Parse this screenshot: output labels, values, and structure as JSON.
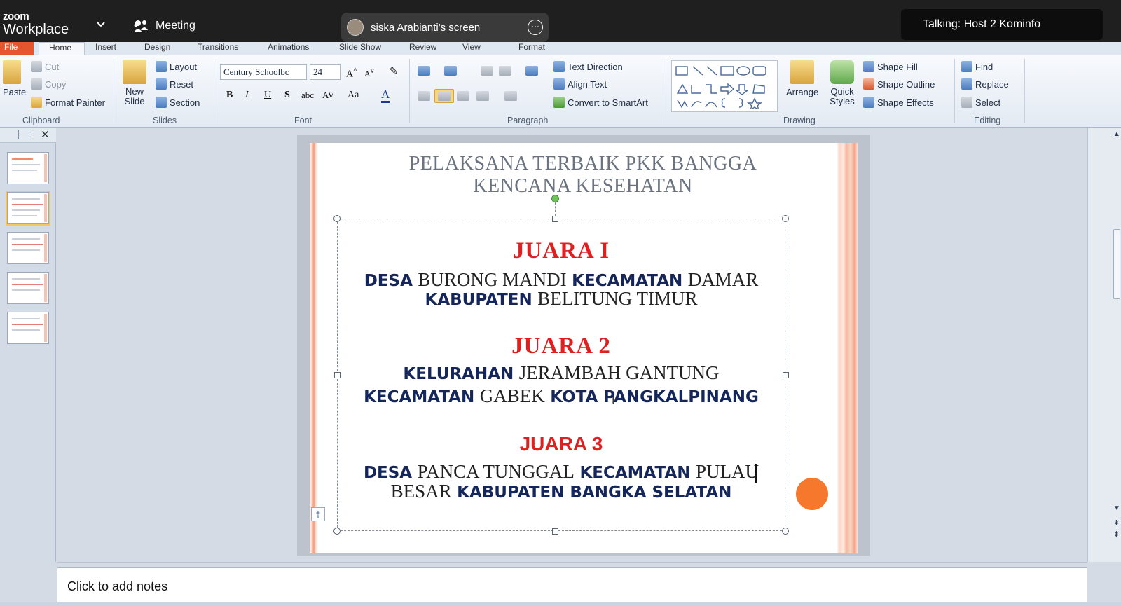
{
  "zoom": {
    "logo_small": "zoom",
    "logo_big": "Workplace",
    "meeting_label": "Meeting",
    "share_label": "siska Arabianti's screen",
    "more_label": "···",
    "talking": "Talking: Host 2 Kominfo"
  },
  "ribbon": {
    "tabs": [
      "File",
      "Home",
      "Insert",
      "Design",
      "Transitions",
      "Animations",
      "Slide Show",
      "Review",
      "View",
      "Format"
    ],
    "clipboard": {
      "paste": "Paste",
      "cut": "Cut",
      "copy": "Copy",
      "format_painter": "Format Painter",
      "group": "Clipboard"
    },
    "slides": {
      "new_slide": "New Slide",
      "layout": "Layout",
      "reset": "Reset",
      "section": "Section",
      "group": "Slides"
    },
    "font": {
      "family": "Century Schoolbc",
      "size": "24",
      "bold": "B",
      "italic": "I",
      "underline": "U",
      "shadow": "S",
      "strike": "abc",
      "spacing": "AV",
      "case": "Aa",
      "color": "A",
      "group": "Font"
    },
    "paragraph": {
      "text_direction": "Text Direction",
      "align_text": "Align Text",
      "convert_smartart": "Convert to SmartArt",
      "group": "Paragraph"
    },
    "drawing": {
      "arrange": "Arrange",
      "quick_styles": "Quick Styles",
      "shape_fill": "Shape Fill",
      "shape_outline": "Shape Outline",
      "shape_effects": "Shape Effects",
      "group": "Drawing"
    },
    "editing": {
      "find": "Find",
      "replace": "Replace",
      "select": "Select",
      "group": "Editing"
    }
  },
  "slide": {
    "title_line1": "PELAKSANA TERBAIK PKK  BANGGA",
    "title_line2": "KENCANA KESEHATAN",
    "j1": "JUARA I",
    "j1_l1": [
      "DESA",
      "BURONG MANDI",
      "KECAMATAN",
      "DAMAR"
    ],
    "j1_l2": [
      "KABUPATEN",
      "BELITUNG TIMUR"
    ],
    "j2": "JUARA 2",
    "j2_l1": [
      "KELURAHAN",
      "JERAMBAH GANTUNG"
    ],
    "j2_l2": [
      "KECAMATAN",
      "GABEK",
      "KOTA PANGKALPINANG"
    ],
    "j3": "JUARA 3",
    "j3_l1": [
      "DESA",
      "PANCA TUNGGAL",
      "KECAMATAN",
      "PULAU"
    ],
    "j3_l2": [
      "BESAR",
      "KABUPATEN BANGKA SELATAN"
    ]
  },
  "notes_placeholder": "Click to add notes",
  "colors": {
    "accent_red": "#e02020",
    "navy": "#15275a",
    "orange_dot": "#f5782c"
  }
}
